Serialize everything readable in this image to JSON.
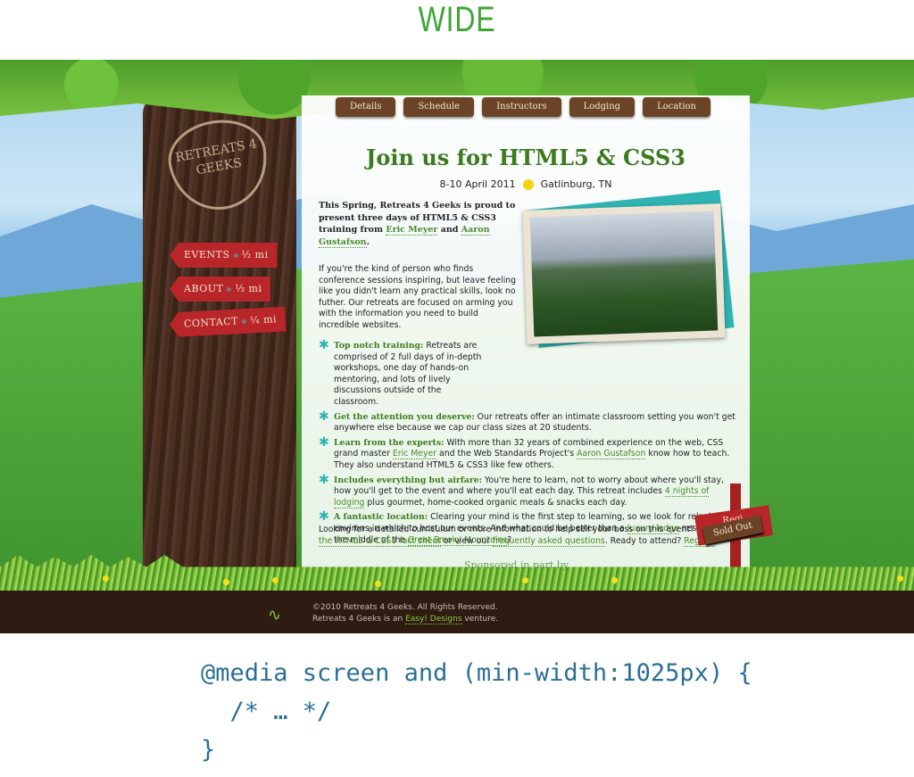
{
  "slide": {
    "title": "WIDE",
    "code": [
      "@media screen and (min-width:1025px) {",
      "  /* … */",
      "}"
    ]
  },
  "site": {
    "logo": "RETREATS 4 GEEKS",
    "nav": [
      "Details",
      "Schedule",
      "Instructors",
      "Lodging",
      "Location"
    ],
    "signs": [
      {
        "label": "EVENTS",
        "dist": "½ mi"
      },
      {
        "label": "ABOUT",
        "dist": "⅓ mi"
      },
      {
        "label": "CONTACT",
        "dist": "¼ mi"
      }
    ],
    "headline": "Join us for HTML5 & CSS3",
    "date": "8-10 April 2011",
    "location": "Gatlinburg, TN",
    "intro": {
      "t1": "This Spring, Retreats 4 Geeks is proud to present three days of HTML5 & CSS3 training from ",
      "l1": "Eric Meyer",
      "t2": " and ",
      "l2": "Aaron Gustafson",
      "t3": "."
    },
    "para": "If you're the kind of person who finds conference sessions inspiring, but leave feeling like you didn't learn any practical skills, look no futher. Our retreats are focused on arming you with the information you need to build incredible websites.",
    "bullets": [
      {
        "title": "Top notch training:",
        "text": " Retreats are comprised of 2 full days of in-depth workshops, one day of hands-on mentoring, and lots of lively discussions outside of the classroom."
      },
      {
        "title": "Get the attention you deserve:",
        "text": " Our retreats offer an intimate classroom setting you won't get anywhere else because we cap our class sizes at 20 students."
      },
      {
        "title": "Learn from the experts:",
        "t1": " With more than 32 years of combined experience on the web, CSS grand master ",
        "l1": "Eric Meyer",
        "t2": " and the Web Standards Project's ",
        "l2": "Aaron Gustafson",
        "t3": " know how to teach. They also understand HTML5 & CSS3 like few others."
      },
      {
        "title": "Includes everything but airfare:",
        "t1": " You're here to learn, not to worry about where you'll stay, how you'll get to the event and where you'll eat each day. This retreat includes ",
        "l1": "4 nights of lodging",
        "t2": " plus gourmet, home-cooked organic meals & snacks each day."
      },
      {
        "title": "A fantastic location:",
        "t1": " Clearing your mind is the first step to learning, so we look for relaxing environs in which to host our events. And what could be better than a ",
        "l1": "luxury lodge",
        "t2": " nestled in the middle of the ",
        "l2": "Great Smoky Mountains",
        "t3": "?"
      }
    ],
    "closing": {
      "t1": "Looking for a detailed curriculum or more information to help sell your boss on this event? ",
      "l1": "Do",
      "t1b": "",
      "l1b": "the HTML5 & CSS3 fact sheet",
      "t2": " or view our ",
      "l2": "frequently asked questions",
      "t3": ". Ready to attend? ",
      "l3": "Registe"
    },
    "sponsored": "Sponsored in part by",
    "register": "Regi",
    "sold_out": "Sold Out",
    "footer": {
      "copy": "©2010 Retreats 4 Geeks. All Rights Reserved.",
      "t1": "Retreats 4 Geeks is an ",
      "link": "Easy! Designs",
      "t2": " venture."
    }
  }
}
